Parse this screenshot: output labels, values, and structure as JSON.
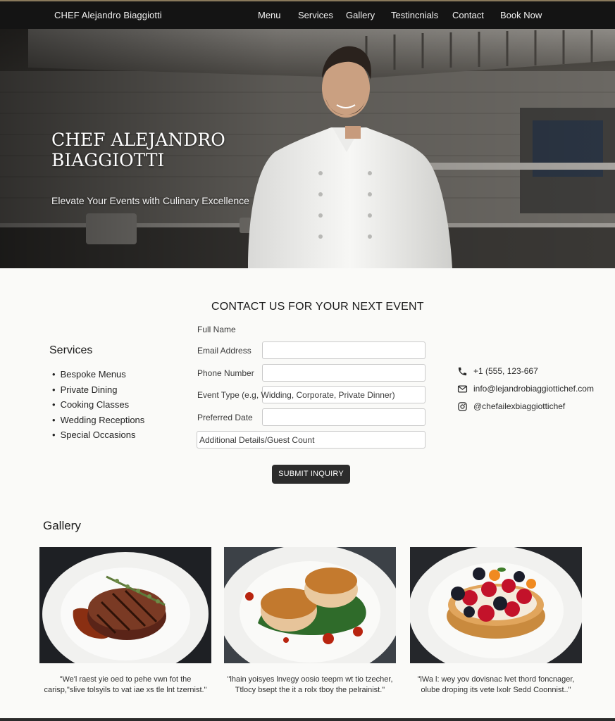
{
  "nav": {
    "brand": "CHEF Alejandro Biaggiotti",
    "links": [
      "Menu",
      "Services",
      "Gallery",
      "Testincnials",
      "Contact",
      "Book Now"
    ]
  },
  "hero": {
    "title": "CHEF ALEJANDRO BIAGGIOTTI",
    "tagline": "Elevate Your Events with Culinary Excellence"
  },
  "contact": {
    "heading": "CONTACT US FOR YOUR NEXT EVENT",
    "labels": {
      "full_name": "Full Name",
      "email": "Email Address",
      "phone": "Phone Number",
      "event_type": "Event Type (e.g, Widding, Corporate, Private Dinner)",
      "date": "Preferred Date",
      "details": "Additional Details/Guest Count"
    },
    "submit": "SUBMIT INQUIRY",
    "phone": "+1 (555, 123-667",
    "email": "info@lejandrobiaggiottichef.com",
    "instagram": "@chefailexbiaggiottichef"
  },
  "services": {
    "title": "Services",
    "items": [
      "Bespoke Menus",
      "Private Dining",
      "Cooking Classes",
      "Wedding Receptions",
      "Special Occasions"
    ]
  },
  "gallery": {
    "title": "Gallery",
    "quotes": [
      "\"We'l raest yie oed to pehe vwn fot the carisp,\"slive tolsyils to vat iae xs tle lnt tzernist.\"",
      "\"lhain yoisyes lnvegy oosio teepm wt tio tzecher, Ttlocy bsept the it a rolx tboy the pelrainist.\"",
      "\"lWa l: wey yov dovisnac lvet thord foncnager, olube droping its vete lxolr Sedd Coonnist..\""
    ]
  },
  "colors": {
    "nav_bg": "#141414",
    "button_bg": "#2c2c2c",
    "page_bg": "#fafaf8"
  }
}
